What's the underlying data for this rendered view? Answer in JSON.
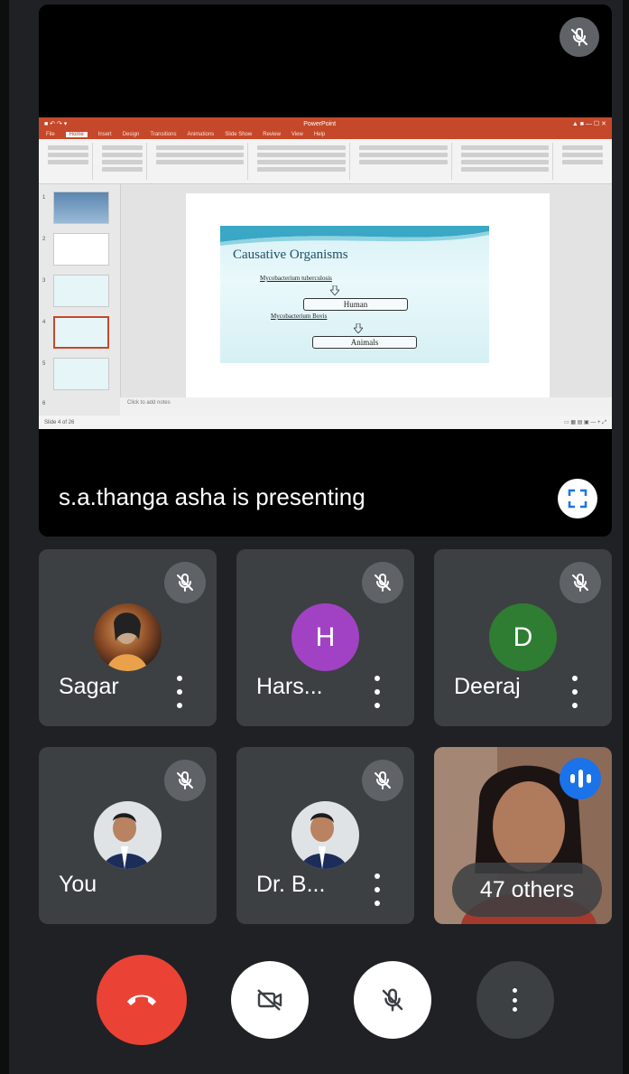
{
  "presentation": {
    "presenter_text": "s.a.thanga asha is presenting",
    "slide": {
      "title": "Causative Organisms",
      "line1": "Mycobacterium tuberculosis",
      "box1": "Human",
      "line2": "Mycobacterium Bovis",
      "box2": "Animals"
    }
  },
  "participants": [
    {
      "name": "Sagar",
      "avatar_type": "photo",
      "muted": true
    },
    {
      "name": "Hars...",
      "initial": "H",
      "avatar_color": "#a142c4",
      "muted": true
    },
    {
      "name": "Deeraj",
      "initial": "D",
      "avatar_color": "#2e7d32",
      "muted": true
    },
    {
      "name": "You",
      "avatar_type": "photo",
      "muted": true
    },
    {
      "name": "Dr. B...",
      "avatar_type": "photo",
      "muted": true
    }
  ],
  "others_label": "47 others",
  "colors": {
    "end_call": "#ea4335",
    "tile_bg": "#3c4043",
    "muted_badge": "#5f6368",
    "speaking_badge": "#1a73e8"
  },
  "icons": {
    "mute": "mic-off-icon",
    "fullscreen": "fullscreen-icon",
    "end_call": "phone-hangup-icon",
    "camera": "camera-off-icon",
    "more": "more-vert-icon"
  }
}
